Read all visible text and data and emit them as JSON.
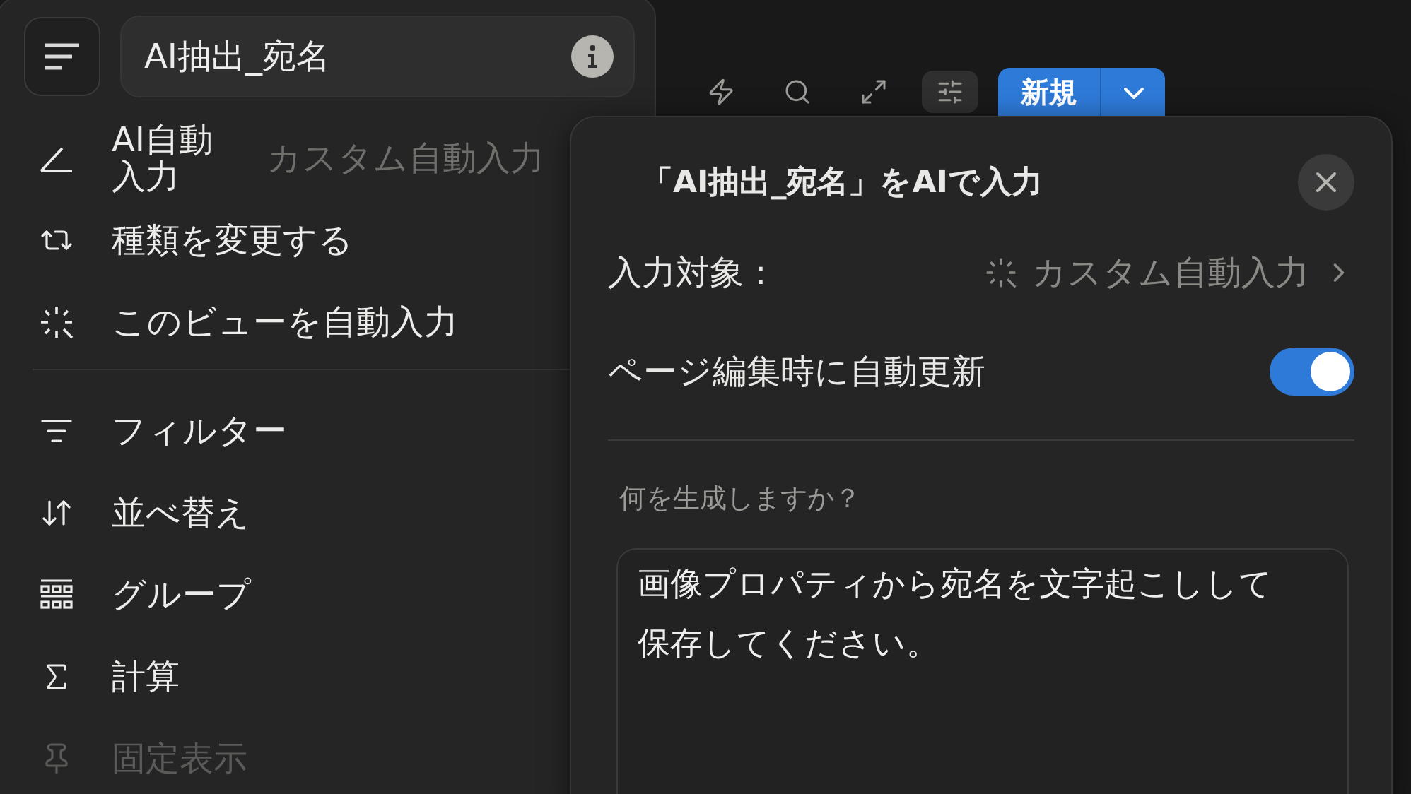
{
  "property": {
    "name": "AI抽出_宛名"
  },
  "toolbar": {
    "tools": [
      {
        "selected": false
      },
      {
        "selected": false
      },
      {
        "selected": false
      },
      {
        "selected": true
      }
    ],
    "new_button": "新規"
  },
  "menu": [
    {
      "kind": "item",
      "label": "AI自動入力",
      "value": "カスタム自動入力",
      "disabled": false
    },
    {
      "kind": "item",
      "label": "種類を変更する",
      "disabled": false
    },
    {
      "kind": "item",
      "label": "このビューを自動入力",
      "disabled": false
    },
    {
      "kind": "divider"
    },
    {
      "kind": "item",
      "label": "フィルター",
      "disabled": false
    },
    {
      "kind": "item",
      "label": "並べ替え",
      "disabled": false
    },
    {
      "kind": "item",
      "label": "グループ",
      "disabled": false
    },
    {
      "kind": "item",
      "label": "計算",
      "disabled": false
    },
    {
      "kind": "item",
      "label": "固定表示",
      "disabled": true
    }
  ],
  "popover": {
    "title": "「AI抽出_宛名」をAIで入力",
    "target_label": "入力対象：",
    "target_value": "カスタム自動入力",
    "auto_update_label": "ページ編集時に自動更新",
    "auto_update_on": true,
    "prompt_label": "何を生成しますか？",
    "prompt_value": "画像プロパティから宛名を文字起こしして保存してください。"
  }
}
